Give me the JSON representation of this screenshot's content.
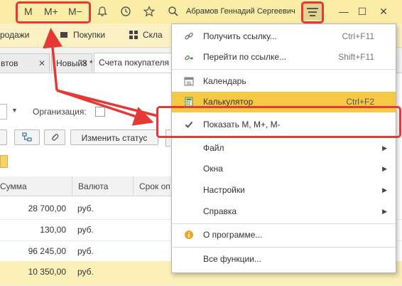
{
  "titlebar": {
    "m": "M",
    "m_plus": "M+",
    "m_minus": "M−",
    "user": "Абрамов Геннадий Сергеевич",
    "window_controls": {
      "minimize": "—",
      "maximize": "☐",
      "close": "✕"
    }
  },
  "sections": [
    {
      "label": "родажи"
    },
    {
      "label": "Покупки"
    },
    {
      "label": "Скла"
    }
  ],
  "tabs": [
    {
      "label": "втов"
    },
    {
      "label": "Новый3 *"
    },
    {
      "label": "Счета покупателя"
    }
  ],
  "filters": {
    "organization_label": "Организация:"
  },
  "toolbar": {
    "change_status_label": "Изменить статус"
  },
  "table": {
    "columns": [
      "Сумма",
      "Валюта",
      "Срок оп"
    ],
    "rows": [
      {
        "sum": "28 700,00",
        "currency": "руб."
      },
      {
        "sum": "130,00",
        "currency": "руб."
      },
      {
        "sum": "96 245,00",
        "currency": "руб."
      },
      {
        "sum": "10 350,00",
        "currency": "руб."
      }
    ]
  },
  "menu": {
    "items": [
      {
        "label": "Получить ссылку...",
        "shortcut": "Ctrl+F11",
        "icon": "link-icon"
      },
      {
        "label": "Перейти по ссылке...",
        "shortcut": "Shift+F11",
        "icon": "goto-link-icon"
      },
      {
        "label": "Календарь",
        "shortcut": "",
        "icon": "calendar-icon"
      },
      {
        "label": "Калькулятор",
        "shortcut": "Ctrl+F2",
        "icon": "calculator-icon"
      },
      {
        "label": "Показать M, M+, M-",
        "shortcut": "",
        "icon": "checkmark-icon"
      },
      {
        "label": "Файл",
        "shortcut": "",
        "icon": ""
      },
      {
        "label": "Окна",
        "shortcut": "",
        "icon": ""
      },
      {
        "label": "Настройки",
        "shortcut": "",
        "icon": ""
      },
      {
        "label": "Справка",
        "shortcut": "",
        "icon": ""
      },
      {
        "label": "О программе...",
        "shortcut": "",
        "icon": "info-icon"
      },
      {
        "label": "Все функции...",
        "shortcut": "",
        "icon": ""
      }
    ]
  },
  "colors": {
    "titlebar": "#fbeda6",
    "highlight": "#f6c944",
    "selected_row": "#fbf0b8",
    "annotation": "#e53935"
  }
}
